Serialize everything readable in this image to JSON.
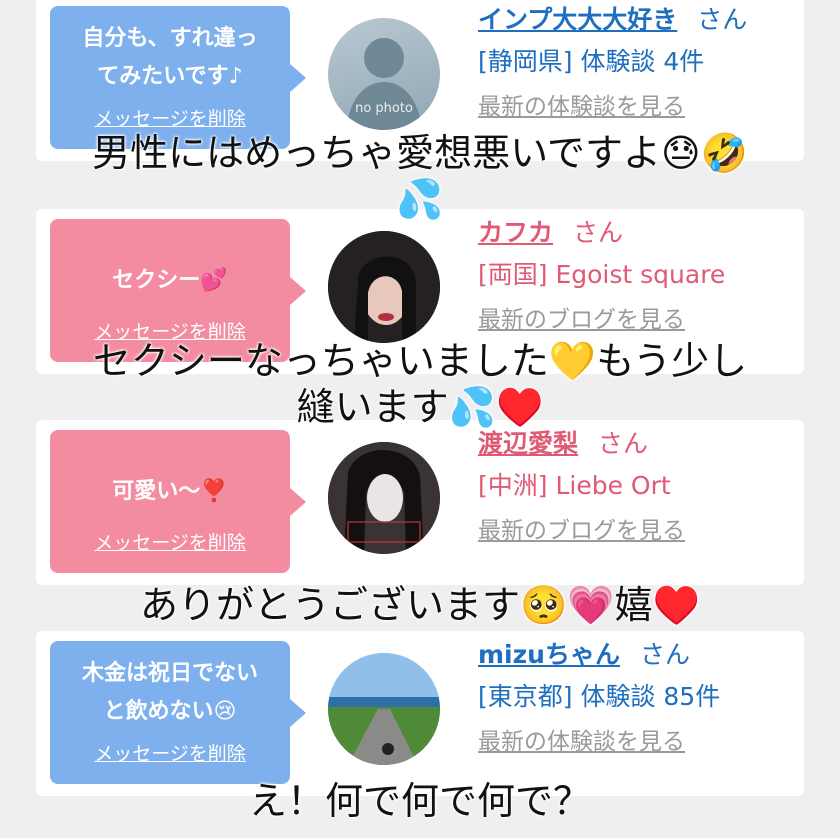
{
  "colors": {
    "blue_accent": "#7fb0ee",
    "pink_accent": "#f48ca1",
    "blue_text": "#1e6fbf",
    "pink_text": "#e05a73",
    "grey_link": "#9a9a9a"
  },
  "cards": [
    {
      "message_line1": "自分も、すれ違っ",
      "message_line2": "てみたいです♪",
      "delete_label": "メッセージを削除",
      "name": "インプ大大大好き",
      "suffix": "さん",
      "detail": "[静岡県] 体験談 4件",
      "link": "最新の体験談を見る",
      "avatar_label": "no photo"
    },
    {
      "message_line1": "セクシー💕",
      "message_line2": "",
      "delete_label": "メッセージを削除",
      "name": "カフカ",
      "suffix": "さん",
      "detail": "[両国] Egoist square",
      "link": "最新のブログを見る"
    },
    {
      "message_line1": "可愛い〜❣️",
      "message_line2": "",
      "delete_label": "メッセージを削除",
      "name": "渡辺愛梨",
      "suffix": "さん",
      "detail": "[中洲] Liebe Ort",
      "link": "最新のブログを見る"
    },
    {
      "message_line1": "木金は祝日でない",
      "message_line2": "と飲めない😢",
      "delete_label": "メッセージを削除",
      "name": "mizuちゃん",
      "suffix": "さん",
      "detail": "[東京都] 体験談 85件",
      "link": "最新の体験談を見る"
    }
  ],
  "captions": {
    "c1_line1": "男性にはめっちゃ愛想悪いですよ😓🤣",
    "c1_line2": "💦",
    "c2_line1": "セクシーなっちゃいました💛もう少し",
    "c2_line2": "縫います💦♥️",
    "c3": "ありがとうございます🥺💗嬉♥️",
    "c4": "え！何で何で何で？"
  }
}
